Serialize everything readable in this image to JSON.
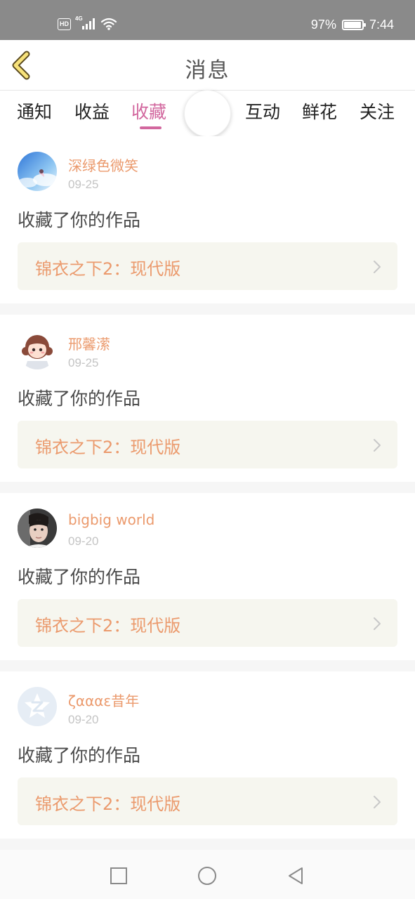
{
  "status_bar": {
    "hd": "HD",
    "network": "4G",
    "battery_percent": "97%",
    "battery_level": 0.97,
    "time": "7:44"
  },
  "header": {
    "title": "消息",
    "back_icon": "chevron-left-icon"
  },
  "tabs": [
    {
      "label": "通知",
      "active": false
    },
    {
      "label": "收益",
      "active": false
    },
    {
      "label": "收藏",
      "active": true
    },
    {
      "label": "互动",
      "active": false
    },
    {
      "label": "鲜花",
      "active": false
    },
    {
      "label": "关注",
      "active": false
    }
  ],
  "notifications": [
    {
      "username": "深绿色微笑",
      "date": "09-25",
      "action": "收藏了你的作品",
      "work_title": "锦衣之下2：现代版"
    },
    {
      "username": "邢馨潆",
      "date": "09-25",
      "action": "收藏了你的作品",
      "work_title": "锦衣之下2：现代版"
    },
    {
      "username": "bigbig world",
      "date": "09-20",
      "action": "收藏了你的作品",
      "work_title": "锦衣之下2：现代版"
    },
    {
      "username": "ζαααε昔年",
      "date": "09-20",
      "action": "收藏了你的作品",
      "work_title": "锦衣之下2：现代版"
    }
  ],
  "nav_bar": {
    "recent_icon": "square-icon",
    "home_icon": "circle-icon",
    "back_icon": "triangle-back-icon"
  },
  "colors": {
    "accent": "#d2679e",
    "username": "#eb9a6d",
    "status_bar": "#8a8a8a",
    "card_bg": "#f6f6ef"
  }
}
